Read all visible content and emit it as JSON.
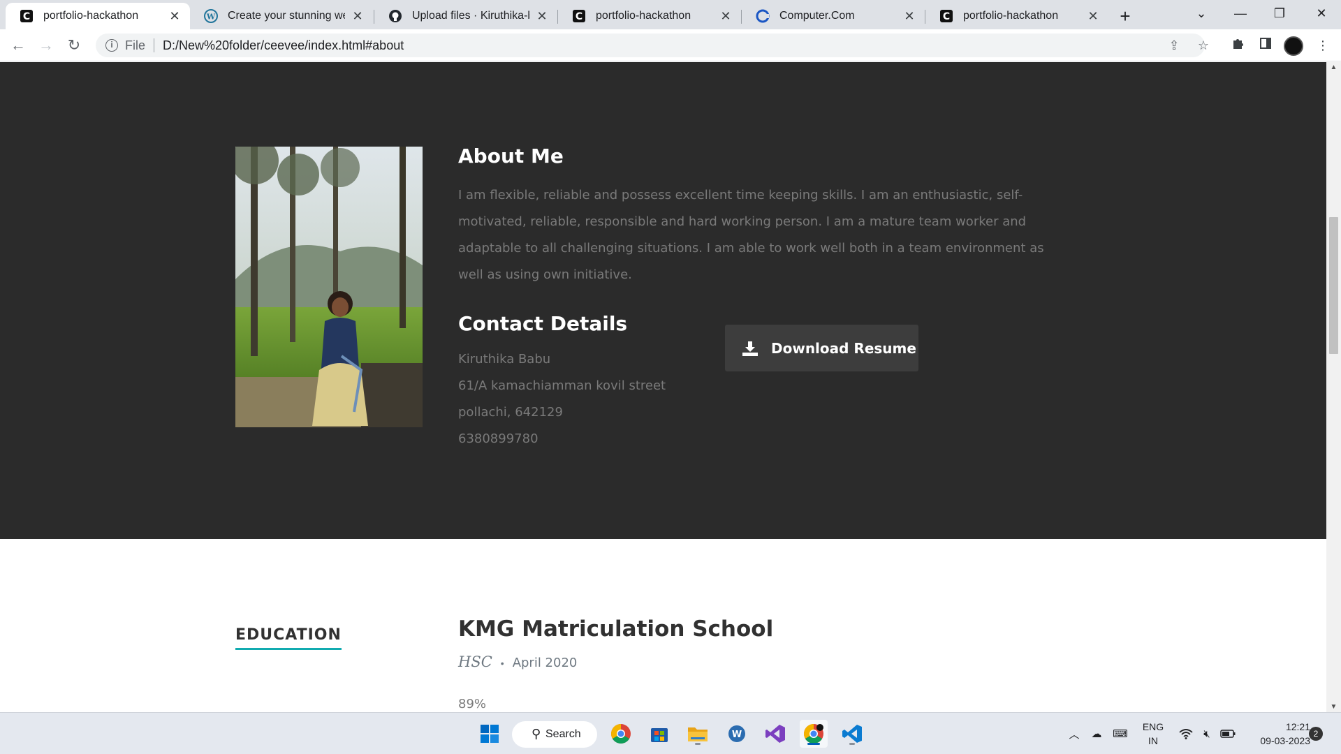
{
  "browser": {
    "tabs": [
      {
        "title": "portfolio-hackathon",
        "icon": "codepen-c-icon",
        "active": true
      },
      {
        "title": "Create your stunning websi",
        "icon": "wordpress-icon",
        "active": false
      },
      {
        "title": "Upload files · Kiruthika-bab",
        "icon": "github-icon",
        "active": false
      },
      {
        "title": "portfolio-hackathon",
        "icon": "codepen-c-icon",
        "active": false
      },
      {
        "title": "Computer.Com",
        "icon": "computer-com-icon",
        "active": false
      },
      {
        "title": "portfolio-hackathon",
        "icon": "codepen-c-icon",
        "active": false
      }
    ],
    "address": {
      "scheme_label": "File",
      "url": "D:/New%20folder/ceevee/index.html#about"
    }
  },
  "page": {
    "about": {
      "heading": "About Me",
      "bio": "I am flexible, reliable and possess excellent time keeping skills. I am an enthusiastic, self-motivated, reliable, responsible and hard working person. I am a mature team worker and adaptable to all challenging situations. I am able to work well both in a team environment as well as using own initiative."
    },
    "contact": {
      "heading": "Contact Details",
      "name": "Kiruthika Babu",
      "street": "61/A kamachiamman kovil street",
      "city": "pollachi, 642129",
      "phone": "6380899780"
    },
    "download_button": "Download Resume",
    "education": {
      "section_label": "EDUCATION",
      "school": "KMG Matriculation School",
      "degree": "HSC",
      "date": "April 2020",
      "score": "89%"
    }
  },
  "taskbar": {
    "search_label": "Search",
    "language": "ENG",
    "region": "IN",
    "time": "12:21",
    "date": "09-03-2023",
    "notification_count": "2"
  },
  "colors": {
    "about_bg": "#2b2b2b",
    "accent": "#11abb0",
    "button_bg": "#3d3d3d"
  }
}
